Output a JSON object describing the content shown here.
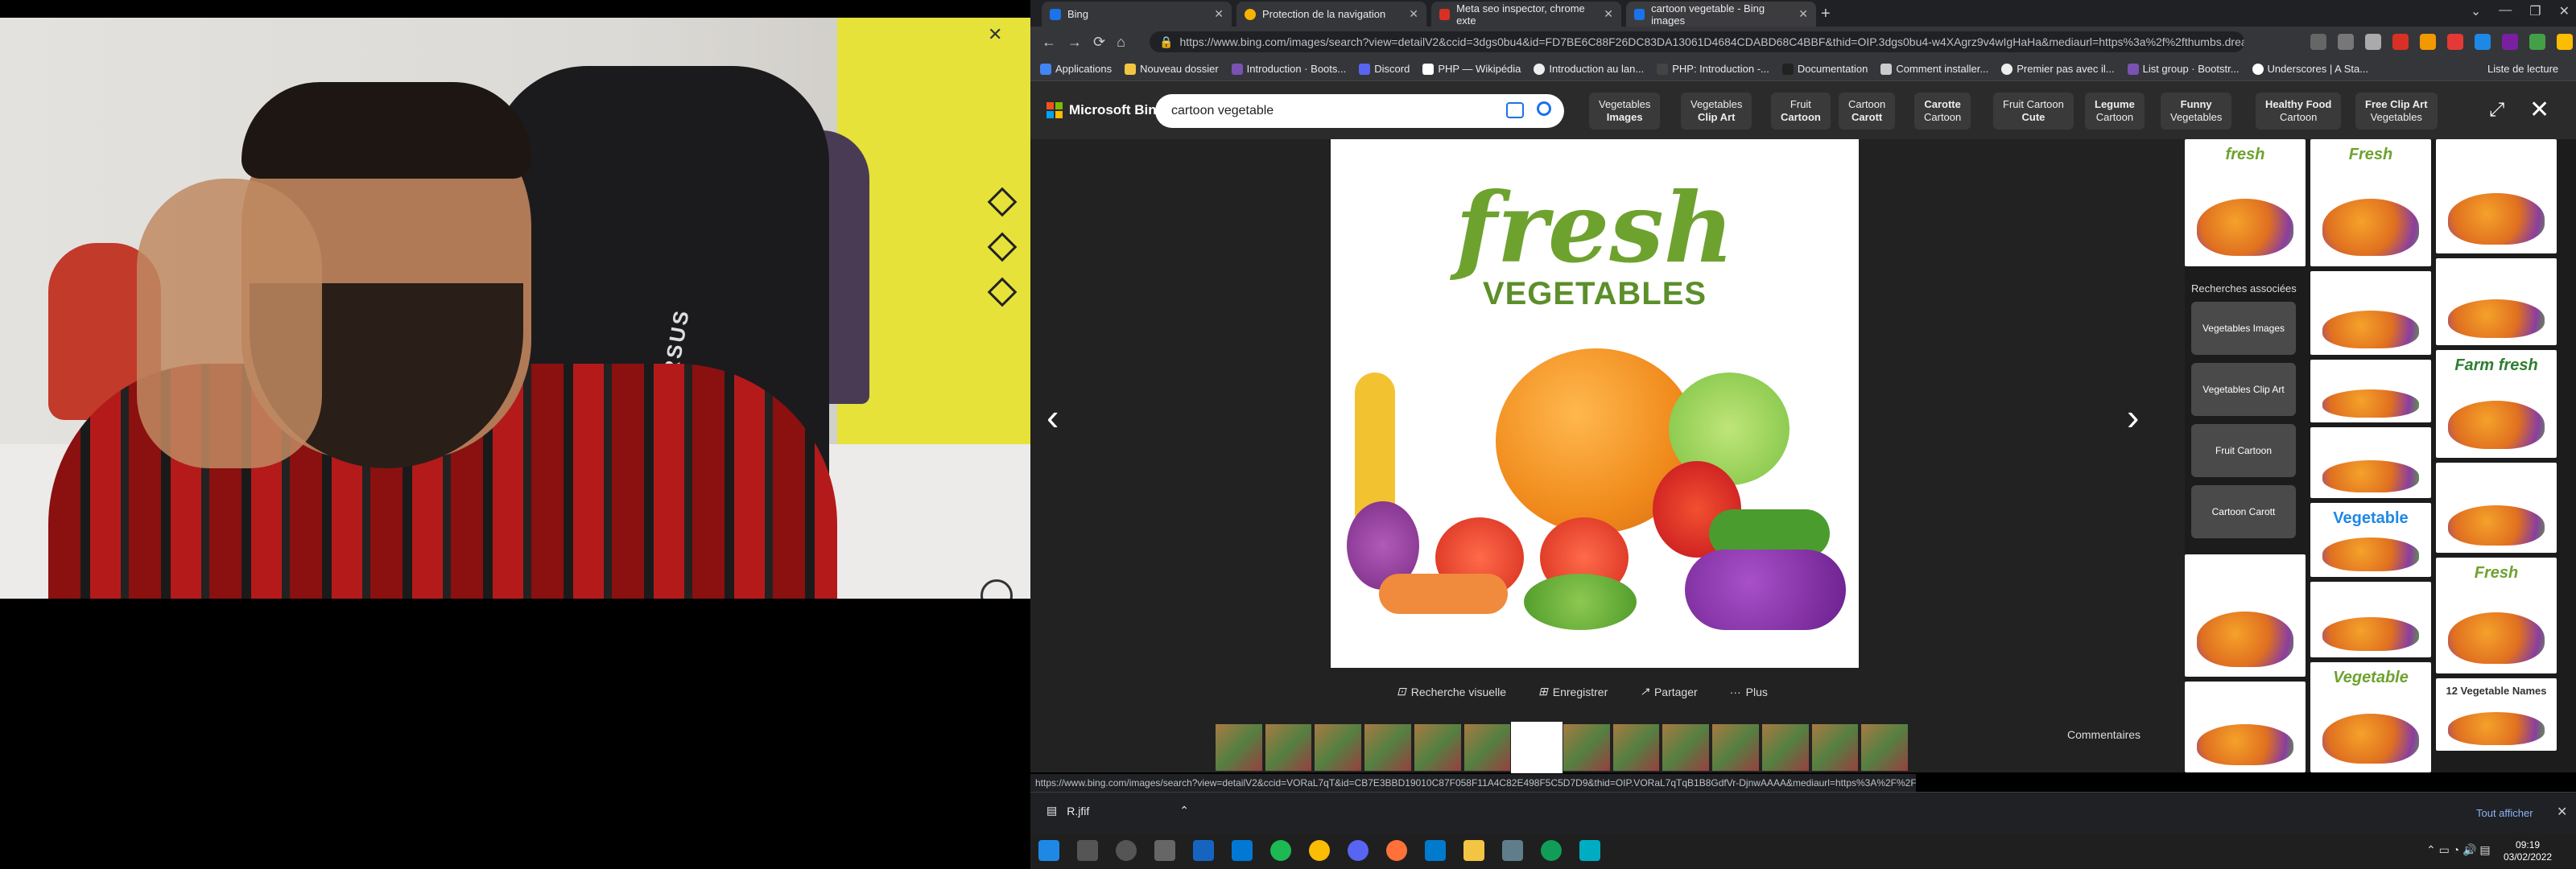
{
  "webcam": {
    "chair_text": "QUERSUS"
  },
  "browser": {
    "tabs": [
      {
        "label": "Bing",
        "color": "#1a73e8"
      },
      {
        "label": "Protection de la navigation",
        "color": "#f4b400"
      },
      {
        "label": "Meta seo inspector, chrome exte",
        "color": "#d93025"
      },
      {
        "label": "cartoon vegetable - Bing images",
        "color": "#1a73e8"
      }
    ],
    "url": "https://www.bing.com/images/search?view=detailV2&ccid=3dgs0bu4&id=FD7BE6C88F26DC83DA13061D4684CDABD68C4BBF&thid=OIP.3dgs0bu4-w4XAgrz9v4wIgHaHa&mediaurl=https%3a%2f%2fthumbs.dreams...",
    "bookmarks": [
      "Applications",
      "Nouveau dossier",
      "Introduction · Boots...",
      "Discord",
      "PHP — Wikipédia",
      "Introduction au lan...",
      "PHP: Introduction -...",
      "Documentation",
      "Comment installer...",
      "Premier pas avec il...",
      "List group · Bootstr...",
      "Underscores | A Sta..."
    ],
    "bookmarks_list": "Liste de lecture"
  },
  "bing": {
    "brand": "Microsoft Bing",
    "query": "cartoon vegetable",
    "chips": [
      {
        "l1": "Vegetables",
        "l2": "Images"
      },
      {
        "l1": "Vegetables",
        "l2": "Clip Art"
      },
      {
        "l1": "Fruit",
        "l2": "Cartoon"
      },
      {
        "l1": "Cartoon",
        "l2": "Carott"
      },
      {
        "l1": "Carotte",
        "l2": "Cartoon"
      },
      {
        "l1": "Fruit Cartoon",
        "l2": "Cute"
      },
      {
        "l1": "Legume",
        "l2": "Cartoon"
      },
      {
        "l1": "Funny",
        "l2": "Vegetables"
      },
      {
        "l1": "Healthy Food",
        "l2": "Cartoon"
      },
      {
        "l1": "Free Clip Art",
        "l2": "Vegetables"
      }
    ],
    "main_image": {
      "title": "fresh",
      "subtitle": "VEGETABLES"
    },
    "actions": {
      "visual": "Recherche visuelle",
      "save": "Enregistrer",
      "share": "Partager",
      "more": "Plus"
    },
    "comments": "Commentaires",
    "related_title": "Recherches associées",
    "related": [
      "Vegetables Images",
      "Vegetables Clip Art",
      "Fruit Cartoon",
      "Cartoon Carott"
    ],
    "side_thumb_texts": [
      "fresh",
      "Fresh",
      "Vegetable",
      "Fresh"
    ],
    "vegetable_label": "Vegetable",
    "twelve_label": "12 Vegetable Names",
    "fresh_farm": "Farm fresh"
  },
  "hover_url": "https://www.bing.com/images/search?view=detailV2&ccid=VORaL7qT&id=CB7E3BBD19010C87F058F11A4C82E498F5C5D7D9&thid=OIP.VORaL7qTqB1B8GdfVr-DjnwAAAA&mediaurl=https%3A%2F%2Fimage.shutterstock.com%2Fimage-vector%2Fhealthy-food-frame-vector-background-450w-378048862.jpg&cdnurl=https%3A%2F%2Fth.bing.com%2Fth...",
  "download": {
    "file": "R.jfif",
    "show_all": "Tout afficher"
  },
  "taskbar": {
    "time": "09:19",
    "date": "03/02/2022"
  }
}
